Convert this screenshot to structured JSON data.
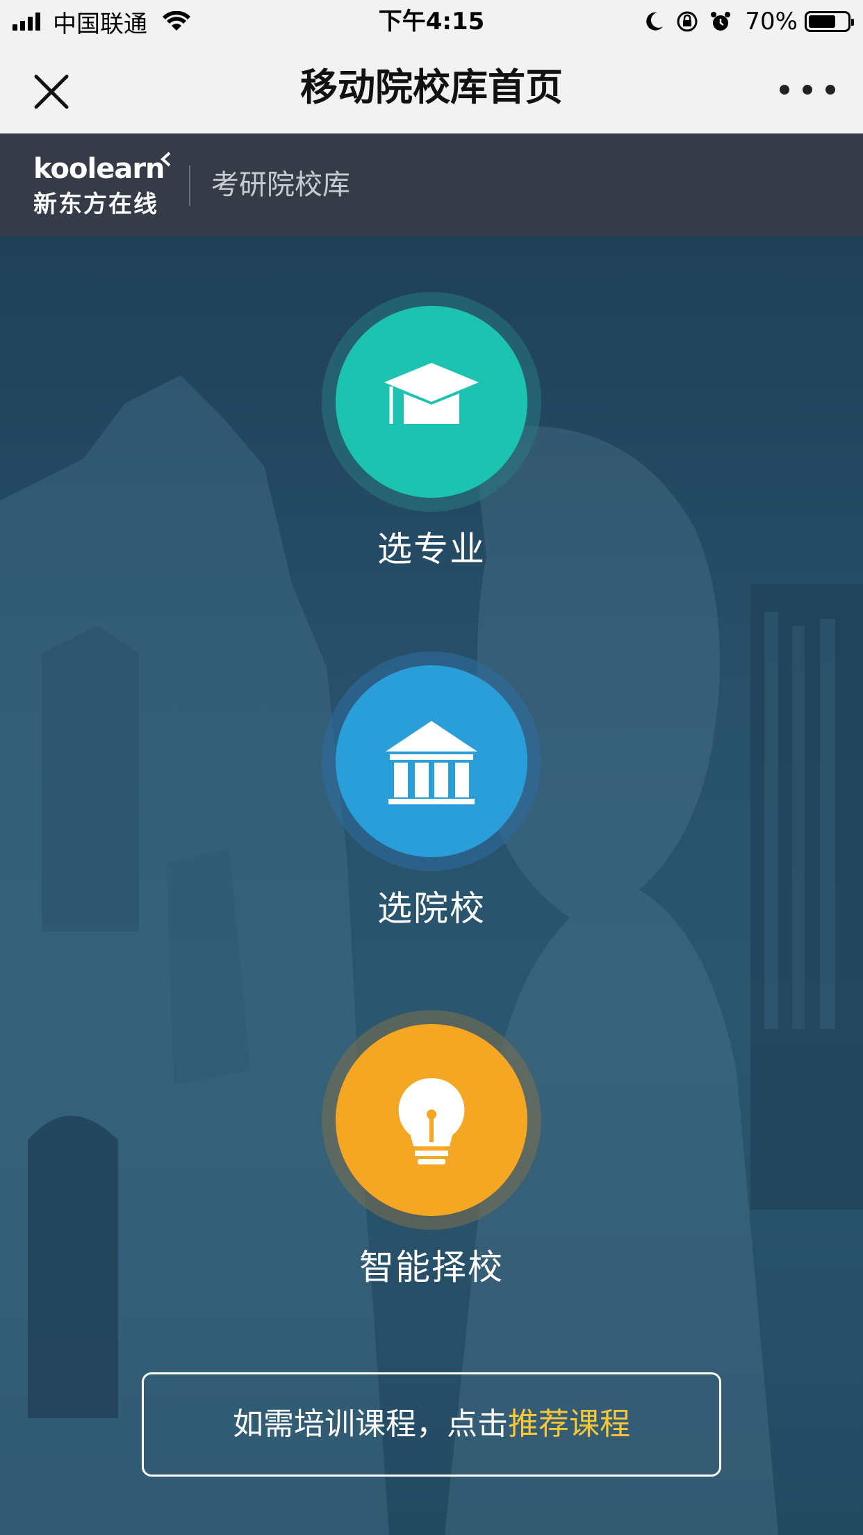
{
  "status_bar": {
    "carrier": "中国联通",
    "time": "下午4:15",
    "battery_percent": "70%",
    "battery_level": 0.7,
    "icons": [
      "signal-icon",
      "wifi-icon",
      "moon-icon",
      "rotation-lock-icon",
      "alarm-icon",
      "battery-icon"
    ]
  },
  "nav": {
    "title": "移动院校库首页",
    "close_icon": "close-icon",
    "more_icon": "more-icon"
  },
  "brand": {
    "logo_word": "koolearn",
    "logo_cn": "新东方在线",
    "subtitle": "考研院校库"
  },
  "actions": [
    {
      "label": "选专业",
      "icon": "graduation-cap-icon",
      "color": "#1cc3b1"
    },
    {
      "label": "选院校",
      "icon": "institution-icon",
      "color": "#2a9ed8"
    },
    {
      "label": "智能择校",
      "icon": "lightbulb-icon",
      "color": "#f5a623"
    }
  ],
  "cta": {
    "prefix": "如需培训课程，点击",
    "link": "推荐课程",
    "link_color": "#f7c73a"
  }
}
